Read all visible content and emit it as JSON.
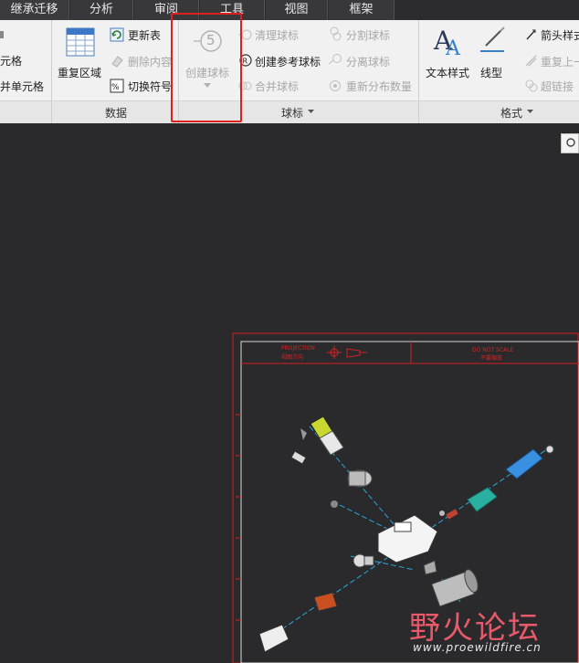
{
  "tabs": [
    "继承迁移",
    "分析",
    "审阅",
    "工具",
    "视图",
    "框架"
  ],
  "ribbon": {
    "left_partial": {
      "item1": "元格",
      "item2": "并单元格"
    },
    "data_group": {
      "label": "数据",
      "repeat_region": "重复区域",
      "update_table": "更新表",
      "delete_content": "删除内容",
      "switch_symbol": "切换符号"
    },
    "balloon_group": {
      "label": "球标",
      "create_balloon": "创建球标",
      "balloon_number": "5",
      "clean_balloon": "清理球标",
      "create_ref_balloon": "创建参考球标",
      "merge_balloon": "合并球标",
      "split_balloon": "分割球标",
      "detach_balloon": "分离球标",
      "redistribute_qty": "重新分布数量"
    },
    "format_group": {
      "label": "格式",
      "text_style": "文本样式",
      "line_style": "线型",
      "arrow_style": "箭头样式",
      "repeat_last": "重复上一",
      "hyperlink": "超链接"
    }
  },
  "drawing": {
    "projection_label": "PROJECTION",
    "projection_sub": "视图方向",
    "scale_label": "DO NOT SCALE",
    "scale_sub": "不要缩放"
  },
  "watermark": {
    "cn": "野火论坛",
    "en": "www.proewildfire.cn"
  },
  "colors": {
    "accent_red": "#e02020",
    "ribbon_bg": "#f1f1f1",
    "canvas_bg": "#2a2a2d"
  }
}
